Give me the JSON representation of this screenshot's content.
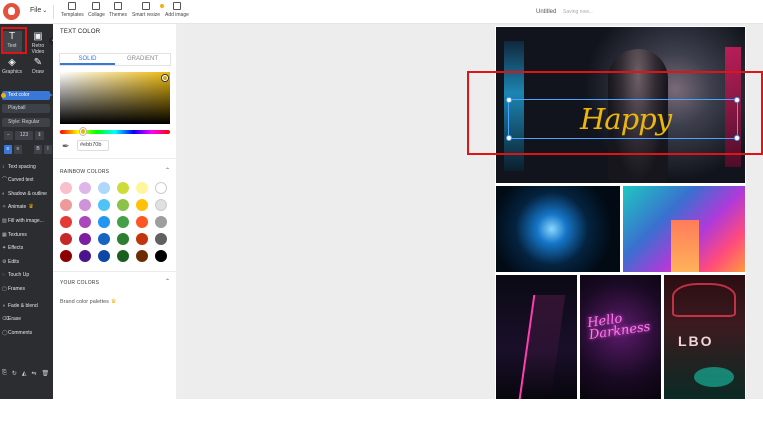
{
  "topbar": {
    "file_label": "File",
    "tools": [
      {
        "label": "Templates",
        "icon": "templates-icon"
      },
      {
        "label": "Collage",
        "icon": "collage-icon"
      },
      {
        "label": "Themes",
        "icon": "themes-icon"
      },
      {
        "label": "Smart resize",
        "icon": "smart-resize-icon"
      },
      {
        "label": "Add image",
        "icon": "add-image-icon"
      }
    ],
    "doc_title": "Untitled",
    "saving_text": "Saving now..."
  },
  "sidebar": {
    "top_buttons": [
      {
        "label": "Text",
        "icon": "text-icon"
      },
      {
        "label": "Retro Video",
        "icon": "camera-icon"
      },
      {
        "label": "Graphics",
        "icon": "graphics-icon"
      },
      {
        "label": "Draw",
        "icon": "pencil-icon"
      }
    ],
    "text_color_label": "Text color",
    "font_label": "Playball",
    "style_label": "Style: Regular",
    "size_value": "123",
    "menu": [
      "Text spacing",
      "Curved text",
      "Shadow & outline",
      "Animate",
      "Fill with image...",
      "Textures",
      "Effects",
      "Edits",
      "Touch Up",
      "Frames",
      "Fade & blend",
      "Erase",
      "Comments"
    ]
  },
  "panel": {
    "title": "TEXT COLOR",
    "tabs": [
      "SOLID",
      "GRADIENT"
    ],
    "hex_value": "#ebb70b",
    "rainbow_title": "RAINBOW COLORS",
    "your_colors_title": "YOUR COLORS",
    "brand_palettes": "Brand color palettes"
  },
  "colors": {
    "accent": "#3a78d8",
    "selected_text_color": "#ebb70b",
    "highlight": "#e01414",
    "swatches": [
      [
        "#f7c0cb",
        "#dfb6ea",
        "#aed7fb",
        "#cddc39",
        "#fff59d",
        "#ffffff"
      ],
      [
        "#ef9a9a",
        "#ce93d8",
        "#4fc3f7",
        "#8bc34a",
        "#ffc107",
        "#e0e0e0"
      ],
      [
        "#e53935",
        "#ab47bc",
        "#2196f3",
        "#43a047",
        "#ff5722",
        "#9e9e9e"
      ],
      [
        "#c62828",
        "#7b1fa2",
        "#1565c0",
        "#2e7d32",
        "#bf360c",
        "#616161"
      ],
      [
        "#8e0000",
        "#4a148c",
        "#0d47a1",
        "#1b5e20",
        "#6d2c00",
        "#000000"
      ]
    ]
  },
  "canvas": {
    "text_layer": "Happy",
    "neon_sign": "Hello Darkness",
    "wall_letters": "LBO"
  }
}
